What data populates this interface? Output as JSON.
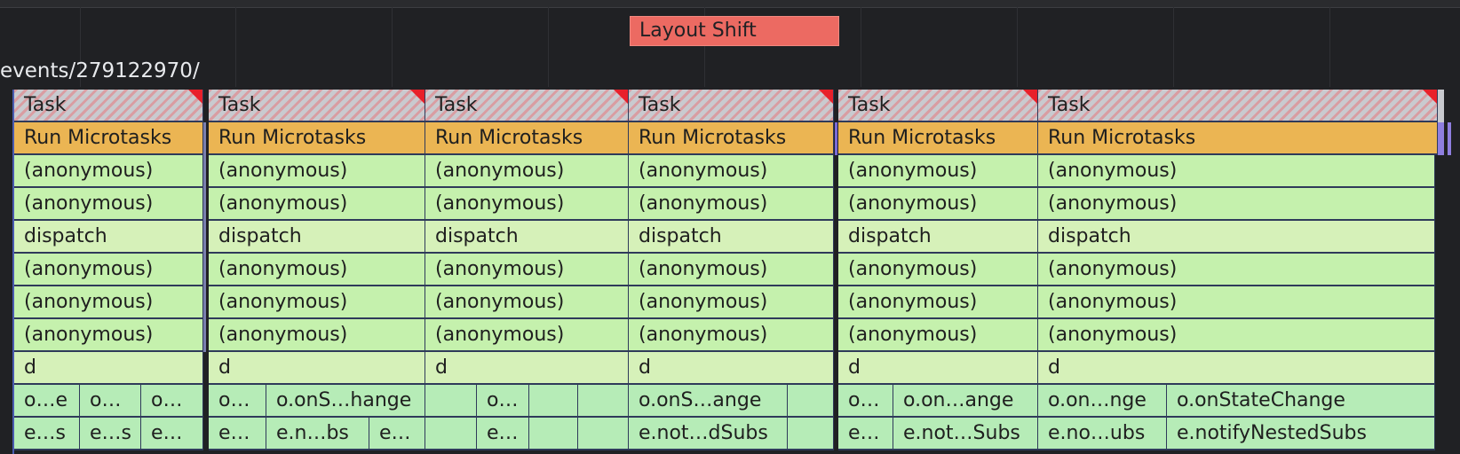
{
  "timeline": {
    "layout_shift_label": "Layout Shift",
    "url_label": "events/279122970/"
  },
  "flame": {
    "task": "Task",
    "run_microtasks": "Run Microtasks",
    "anonymous": "(anonymous)",
    "dispatch": "dispatch",
    "d": "d",
    "col1": {
      "r8": [
        "o…e",
        "o…",
        "o…"
      ],
      "r9": [
        "e…s",
        "e…s",
        "e…"
      ]
    },
    "col2": {
      "r8": [
        "o…",
        "o.onS…hange"
      ],
      "r9": [
        "e…",
        "e.n…bs",
        "e…"
      ]
    },
    "col3": {
      "r8": [
        "o…"
      ],
      "r9": [
        "e…"
      ]
    },
    "col4": {
      "r8": [
        "o.onS…ange"
      ],
      "r9": [
        "e.not…dSubs"
      ]
    },
    "col5": {
      "r8": [
        "o…",
        "o.on…ange"
      ],
      "r9": [
        "e…",
        "e.not…Subs"
      ]
    },
    "col6": {
      "r8": [
        "o.on…nge",
        "o.onStateChange"
      ],
      "r9": [
        "e.no…ubs",
        "e.notifyNestedSubs"
      ]
    }
  },
  "colors": {
    "background": "#202124",
    "task": "#c9cacf",
    "task_corner": "#e8202a",
    "microtasks": "#ebb553",
    "anonymous": "#c5f1ad",
    "dispatch": "#d6f1b9",
    "leaf": "#b6ecb7",
    "layout_shift": "#ec6a62"
  }
}
